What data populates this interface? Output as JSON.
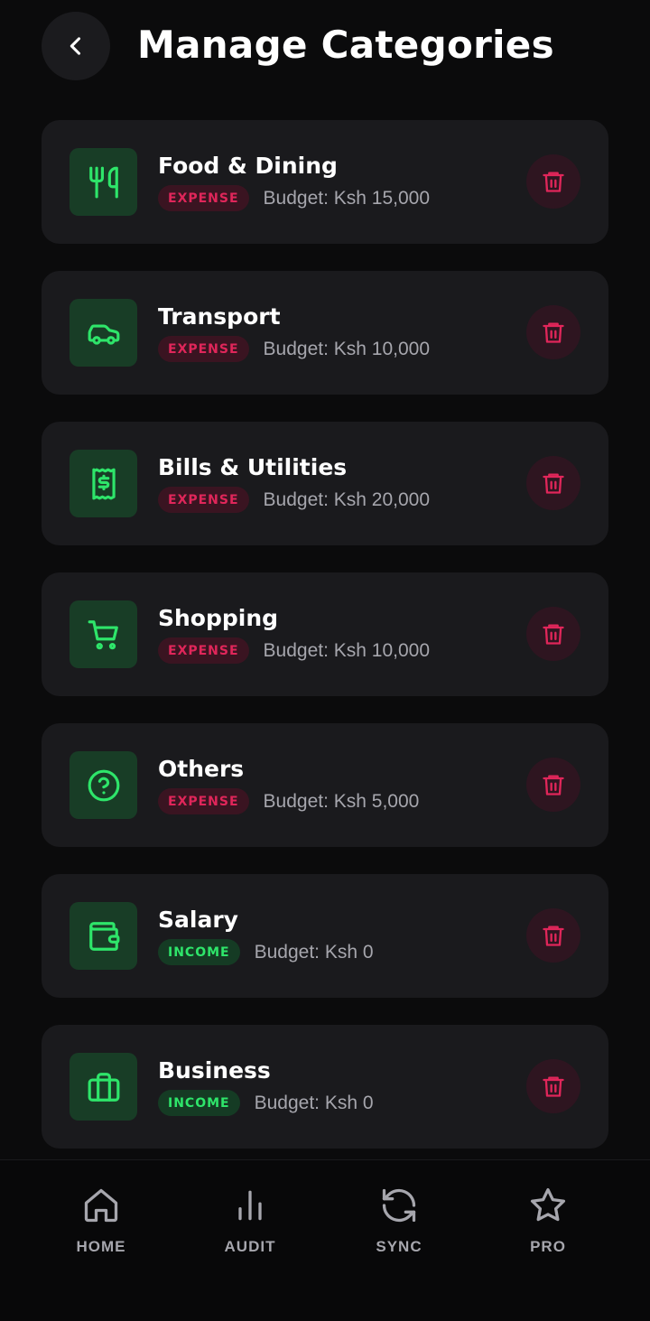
{
  "header": {
    "title": "Manage Categories",
    "back_icon": "chevron-left-icon"
  },
  "categories": [
    {
      "name": "Food & Dining",
      "type": "EXPENSE",
      "budget": "Budget: Ksh 15,000",
      "icon": "fork-knife-icon"
    },
    {
      "name": "Transport",
      "type": "EXPENSE",
      "budget": "Budget: Ksh 10,000",
      "icon": "car-icon"
    },
    {
      "name": "Bills & Utilities",
      "type": "EXPENSE",
      "budget": "Budget: Ksh 20,000",
      "icon": "receipt-icon"
    },
    {
      "name": "Shopping",
      "type": "EXPENSE",
      "budget": "Budget: Ksh 10,000",
      "icon": "cart-icon"
    },
    {
      "name": "Others",
      "type": "EXPENSE",
      "budget": "Budget: Ksh 5,000",
      "icon": "help-circle-icon"
    },
    {
      "name": "Salary",
      "type": "INCOME",
      "budget": "Budget: Ksh 0",
      "icon": "wallet-icon"
    },
    {
      "name": "Business",
      "type": "INCOME",
      "budget": "Budget: Ksh 0",
      "icon": "briefcase-icon"
    }
  ],
  "nav": [
    {
      "label": "HOME",
      "icon": "home-icon"
    },
    {
      "label": "AUDIT",
      "icon": "bar-chart-icon"
    },
    {
      "label": "SYNC",
      "icon": "refresh-icon"
    },
    {
      "label": "PRO",
      "icon": "star-icon"
    }
  ],
  "colors": {
    "accent_green": "#2ee56a",
    "expense_red": "#e0265a",
    "card_bg": "#1a1a1d",
    "page_bg": "#0b0b0c"
  }
}
